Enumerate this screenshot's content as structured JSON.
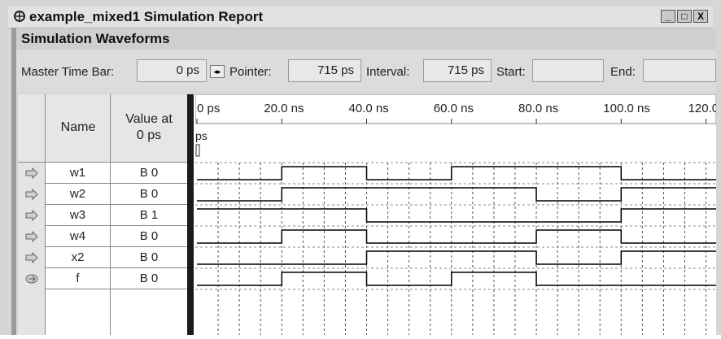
{
  "window": {
    "title": "example_mixed1 Simulation Report",
    "buttons": [
      "_",
      "□",
      "X"
    ]
  },
  "section_title": "Simulation Waveforms",
  "toolbar": {
    "master_time_bar_label": "Master Time Bar:",
    "master_time_bar_value": "0 ps",
    "pointer_label": "Pointer:",
    "pointer_value": "715 ps",
    "interval_label": "Interval:",
    "interval_value": "715 ps",
    "start_label": "Start:",
    "start_value": "",
    "end_label": "End:",
    "end_value": ""
  },
  "table": {
    "col_name": "Name",
    "col_value_line1": "Value at",
    "col_value_line2": "0 ps",
    "rows": [
      {
        "name": "w1",
        "value": "B 0",
        "icon": "input-arrow-icon"
      },
      {
        "name": "w2",
        "value": "B 0",
        "icon": "input-arrow-icon"
      },
      {
        "name": "w3",
        "value": "B 1",
        "icon": "input-arrow-icon"
      },
      {
        "name": "w4",
        "value": "B 0",
        "icon": "input-arrow-icon"
      },
      {
        "name": "x2",
        "value": "B 0",
        "icon": "input-arrow-icon"
      },
      {
        "name": "f",
        "value": "B 0",
        "icon": "output-arrow-icon"
      }
    ]
  },
  "timeline": {
    "ticks": [
      "0 ps",
      "20.0 ns",
      "40.0 ns",
      "60.0 ns",
      "80.0 ns",
      "100.0 ns",
      "120.0 ns"
    ],
    "cursor_label": "ps",
    "time_end_ns": 122
  },
  "waveforms": {
    "w1": [
      [
        0,
        0
      ],
      [
        20,
        1
      ],
      [
        40,
        0
      ],
      [
        60,
        1
      ],
      [
        100,
        0
      ]
    ],
    "w2": [
      [
        0,
        0
      ],
      [
        20,
        1
      ],
      [
        80,
        0
      ],
      [
        100,
        1
      ]
    ],
    "w3": [
      [
        0,
        1
      ],
      [
        40,
        0
      ],
      [
        100,
        1
      ]
    ],
    "w4": [
      [
        0,
        0
      ],
      [
        20,
        1
      ],
      [
        40,
        0
      ],
      [
        60,
        0
      ],
      [
        80,
        1
      ],
      [
        100,
        0
      ]
    ],
    "x2": [
      [
        0,
        0
      ],
      [
        40,
        1
      ],
      [
        80,
        0
      ],
      [
        100,
        1
      ]
    ],
    "f": [
      [
        0,
        0
      ],
      [
        20,
        1
      ],
      [
        40,
        0
      ],
      [
        60,
        1
      ],
      [
        80,
        0
      ]
    ]
  },
  "colors": {
    "waveform": "#000000",
    "grid": "#555555",
    "splitter": "#1a1a1a"
  }
}
